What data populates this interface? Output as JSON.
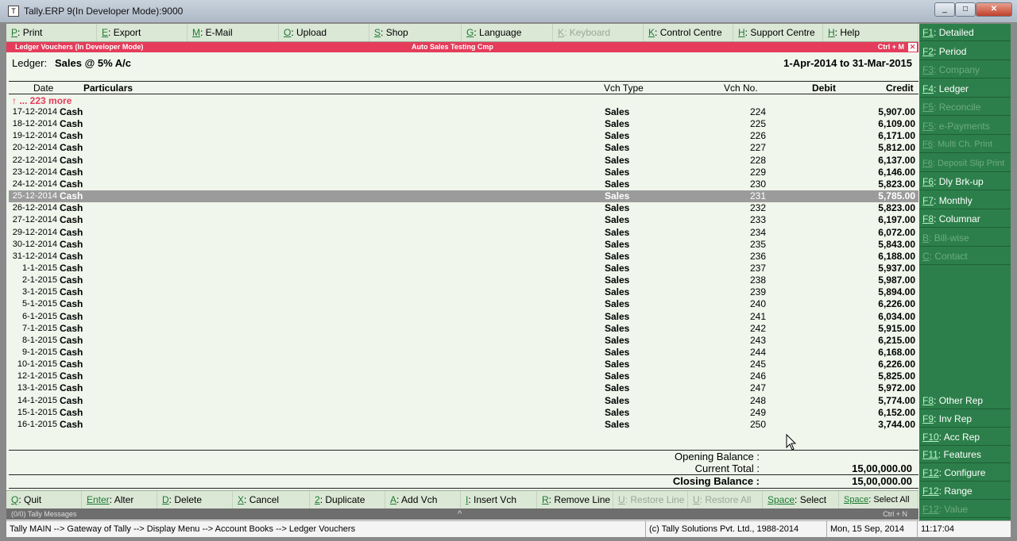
{
  "window": {
    "title": "Tally.ERP 9(In Developer Mode):9000"
  },
  "top_buttons": [
    {
      "key": "P",
      "label": "Print",
      "enabled": true
    },
    {
      "key": "E",
      "label": "Export",
      "enabled": true
    },
    {
      "key": "M",
      "label": "E-Mail",
      "enabled": true
    },
    {
      "key": "O",
      "label": "Upload",
      "enabled": true
    },
    {
      "key": "S",
      "label": "Shop",
      "enabled": true
    },
    {
      "key": "G",
      "label": "Language",
      "enabled": true
    },
    {
      "key": "K",
      "label": "Keyboard",
      "enabled": false
    },
    {
      "key": "K",
      "label": "Control Centre",
      "enabled": true
    },
    {
      "key": "H",
      "label": "Support Centre",
      "enabled": true
    },
    {
      "key": "H",
      "label": "Help",
      "enabled": true
    }
  ],
  "header": {
    "mode": "Ledger Vouchers (In Developer Mode)",
    "company": "Auto Sales Testing Cmp",
    "shortcut": "Ctrl + M",
    "close": "✕"
  },
  "ledger": {
    "label": "Ledger:",
    "name": "Sales @ 5% A/c",
    "period": "1-Apr-2014 to 31-Mar-2015"
  },
  "columns": {
    "date": "Date",
    "particulars": "Particulars",
    "vch_type": "Vch Type",
    "vch_no": "Vch No.",
    "debit": "Debit",
    "credit": "Credit"
  },
  "more_text": "↑ ... 223 more",
  "rows": [
    {
      "date": "17-12-2014",
      "particulars": "Cash",
      "type": "Sales",
      "no": "224",
      "credit": "5,907.00"
    },
    {
      "date": "18-12-2014",
      "particulars": "Cash",
      "type": "Sales",
      "no": "225",
      "credit": "6,109.00"
    },
    {
      "date": "19-12-2014",
      "particulars": "Cash",
      "type": "Sales",
      "no": "226",
      "credit": "6,171.00"
    },
    {
      "date": "20-12-2014",
      "particulars": "Cash",
      "type": "Sales",
      "no": "227",
      "credit": "5,812.00"
    },
    {
      "date": "22-12-2014",
      "particulars": "Cash",
      "type": "Sales",
      "no": "228",
      "credit": "6,137.00"
    },
    {
      "date": "23-12-2014",
      "particulars": "Cash",
      "type": "Sales",
      "no": "229",
      "credit": "6,146.00"
    },
    {
      "date": "24-12-2014",
      "particulars": "Cash",
      "type": "Sales",
      "no": "230",
      "credit": "5,823.00"
    },
    {
      "date": "25-12-2014",
      "particulars": "Cash",
      "type": "Sales",
      "no": "231",
      "credit": "5,785.00",
      "selected": true
    },
    {
      "date": "26-12-2014",
      "particulars": "Cash",
      "type": "Sales",
      "no": "232",
      "credit": "5,823.00"
    },
    {
      "date": "27-12-2014",
      "particulars": "Cash",
      "type": "Sales",
      "no": "233",
      "credit": "6,197.00"
    },
    {
      "date": "29-12-2014",
      "particulars": "Cash",
      "type": "Sales",
      "no": "234",
      "credit": "6,072.00"
    },
    {
      "date": "30-12-2014",
      "particulars": "Cash",
      "type": "Sales",
      "no": "235",
      "credit": "5,843.00"
    },
    {
      "date": "31-12-2014",
      "particulars": "Cash",
      "type": "Sales",
      "no": "236",
      "credit": "6,188.00"
    },
    {
      "date": "1-1-2015",
      "particulars": "Cash",
      "type": "Sales",
      "no": "237",
      "credit": "5,937.00"
    },
    {
      "date": "2-1-2015",
      "particulars": "Cash",
      "type": "Sales",
      "no": "238",
      "credit": "5,987.00"
    },
    {
      "date": "3-1-2015",
      "particulars": "Cash",
      "type": "Sales",
      "no": "239",
      "credit": "5,894.00"
    },
    {
      "date": "5-1-2015",
      "particulars": "Cash",
      "type": "Sales",
      "no": "240",
      "credit": "6,226.00"
    },
    {
      "date": "6-1-2015",
      "particulars": "Cash",
      "type": "Sales",
      "no": "241",
      "credit": "6,034.00"
    },
    {
      "date": "7-1-2015",
      "particulars": "Cash",
      "type": "Sales",
      "no": "242",
      "credit": "5,915.00"
    },
    {
      "date": "8-1-2015",
      "particulars": "Cash",
      "type": "Sales",
      "no": "243",
      "credit": "6,215.00"
    },
    {
      "date": "9-1-2015",
      "particulars": "Cash",
      "type": "Sales",
      "no": "244",
      "credit": "6,168.00"
    },
    {
      "date": "10-1-2015",
      "particulars": "Cash",
      "type": "Sales",
      "no": "245",
      "credit": "6,226.00"
    },
    {
      "date": "12-1-2015",
      "particulars": "Cash",
      "type": "Sales",
      "no": "246",
      "credit": "5,825.00"
    },
    {
      "date": "13-1-2015",
      "particulars": "Cash",
      "type": "Sales",
      "no": "247",
      "credit": "5,972.00"
    },
    {
      "date": "14-1-2015",
      "particulars": "Cash",
      "type": "Sales",
      "no": "248",
      "credit": "5,774.00"
    },
    {
      "date": "15-1-2015",
      "particulars": "Cash",
      "type": "Sales",
      "no": "249",
      "credit": "6,152.00"
    },
    {
      "date": "16-1-2015",
      "particulars": "Cash",
      "type": "Sales",
      "no": "250",
      "credit": "3,744.00"
    }
  ],
  "totals": {
    "opening_label": "Opening Balance :",
    "opening_value": "",
    "current_label": "Current Total :",
    "current_value": "15,00,000.00",
    "closing_label": "Closing Balance :",
    "closing_value": "15,00,000.00"
  },
  "bottom_buttons": [
    {
      "key": "Q",
      "label": "Quit",
      "enabled": true
    },
    {
      "key": "Enter",
      "label": "Alter",
      "enabled": true
    },
    {
      "key": "D",
      "label": "Delete",
      "enabled": true
    },
    {
      "key": "X",
      "label": "Cancel",
      "enabled": true
    },
    {
      "key": "2",
      "label": "Duplicate",
      "enabled": true
    },
    {
      "key": "A",
      "label": "Add Vch",
      "enabled": true
    },
    {
      "key": "I",
      "label": "Insert Vch",
      "enabled": true
    },
    {
      "key": "R",
      "label": "Remove Line",
      "enabled": true
    },
    {
      "key": "U",
      "label": "Restore Line",
      "enabled": false
    },
    {
      "key": "U",
      "label": "Restore All",
      "enabled": false
    },
    {
      "key": "Space",
      "label": "Select",
      "enabled": true
    },
    {
      "key": "Space",
      "label": "Select All",
      "enabled": true
    }
  ],
  "messages": {
    "text": "(0/0) Tally Messages",
    "arrow": "^",
    "shortcut": "Ctrl + N"
  },
  "status": {
    "path": "Tally MAIN --> Gateway of Tally --> Display Menu --> Account Books --> Ledger Vouchers",
    "copyright": "(c) Tally Solutions Pvt. Ltd., 1988-2014",
    "date": "Mon, 15 Sep, 2014",
    "time": "11:17:04"
  },
  "side_buttons": [
    {
      "key": "F1",
      "label": "Detailed",
      "enabled": true
    },
    {
      "key": "F2",
      "label": "Period",
      "enabled": true
    },
    {
      "key": "F3",
      "label": "Company",
      "enabled": false
    },
    {
      "key": "F4",
      "label": "Ledger",
      "enabled": true
    },
    {
      "key": "F5",
      "label": "Reconcile",
      "enabled": false
    },
    {
      "key": "F5",
      "label": "e-Payments",
      "enabled": false
    },
    {
      "key": "F6",
      "label": "Multi Ch. Print",
      "enabled": false
    },
    {
      "key": "F6",
      "label": "Deposit Slip Print",
      "enabled": false
    },
    {
      "key": "F6",
      "label": "Dly Brk-up",
      "enabled": true
    },
    {
      "key": "F7",
      "label": "Monthly",
      "enabled": true
    },
    {
      "key": "F8",
      "label": "Columnar",
      "enabled": true
    },
    {
      "key": "B",
      "label": "Bill-wise",
      "enabled": false
    },
    {
      "key": "C",
      "label": "Contact",
      "enabled": false
    }
  ],
  "side_buttons_bottom": [
    {
      "key": "F8",
      "label": "Other Rep",
      "enabled": true
    },
    {
      "key": "F9",
      "label": "Inv Rep",
      "enabled": true
    },
    {
      "key": "F10",
      "label": "Acc Rep",
      "enabled": true
    },
    {
      "key": "F11",
      "label": "Features",
      "enabled": true
    },
    {
      "key": "F12",
      "label": "Configure",
      "enabled": true
    },
    {
      "key": "F12",
      "label": "Range",
      "enabled": true
    },
    {
      "key": "F12",
      "label": "Value",
      "enabled": false
    }
  ]
}
